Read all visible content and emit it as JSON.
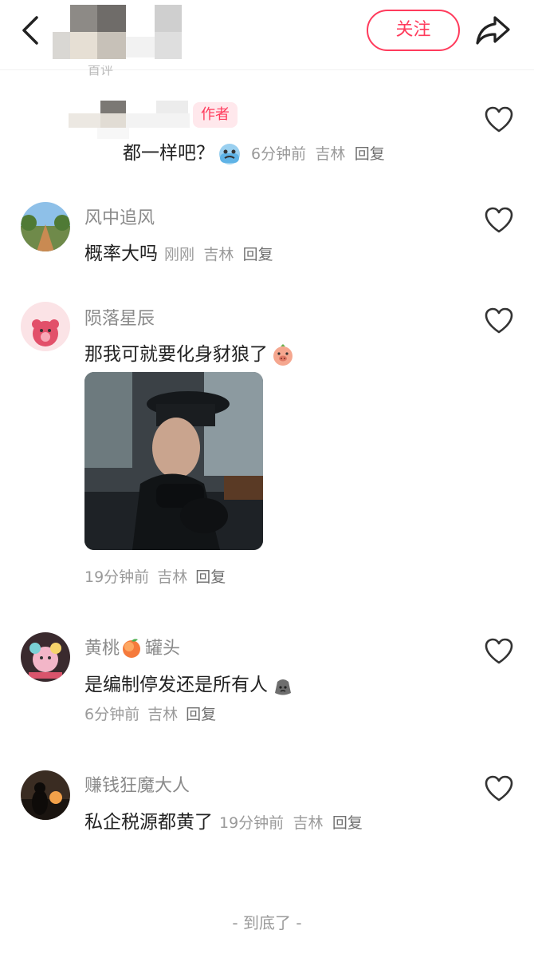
{
  "header": {
    "follow_label": "关注"
  },
  "cut_label": "首评",
  "comments": [
    {
      "content": "都一样吧？",
      "time": "6分钟前",
      "location": "吉林",
      "reply": "回复",
      "badge": "作者"
    },
    {
      "username": "风中追风",
      "content": "概率大吗",
      "time": "刚刚",
      "location": "吉林",
      "reply": "回复"
    },
    {
      "username": "陨落星辰",
      "content": "那我可就要化身豺狼了",
      "time": "19分钟前",
      "location": "吉林",
      "reply": "回复"
    },
    {
      "username_prefix": "黄桃",
      "username_suffix": "罐头",
      "content": "是编制停发还是所有人",
      "time": "6分钟前",
      "location": "吉林",
      "reply": "回复"
    },
    {
      "username": "赚钱狂魔大人",
      "content": "私企税源都黄了",
      "time": "19分钟前",
      "location": "吉林",
      "reply": "回复"
    }
  ],
  "footer": {
    "end_text": "- 到底了 -"
  },
  "colors": {
    "accent": "#ff3b5c",
    "meta": "#9a9a9a",
    "username": "#8a8a8a"
  },
  "icons": [
    "back-icon",
    "share-icon",
    "heart-icon",
    "peach-emoji",
    "crying-emoji",
    "pig-emoji",
    "bag-emoji"
  ]
}
